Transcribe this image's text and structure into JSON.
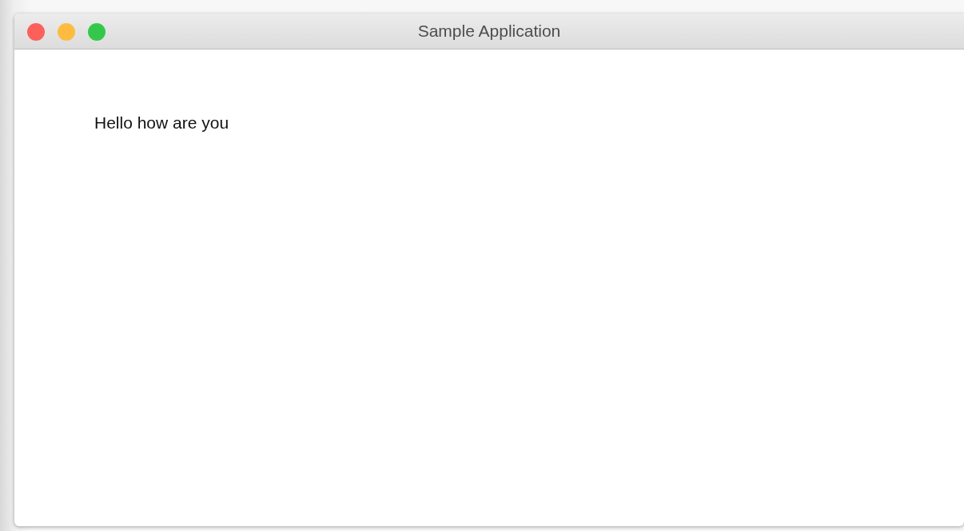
{
  "window": {
    "title": "Sample Application",
    "controls": [
      {
        "color": "#fc605b"
      },
      {
        "color": "#fdbc40"
      },
      {
        "color": "#34c84a"
      }
    ]
  },
  "content": {
    "text": "Hello how are you"
  }
}
